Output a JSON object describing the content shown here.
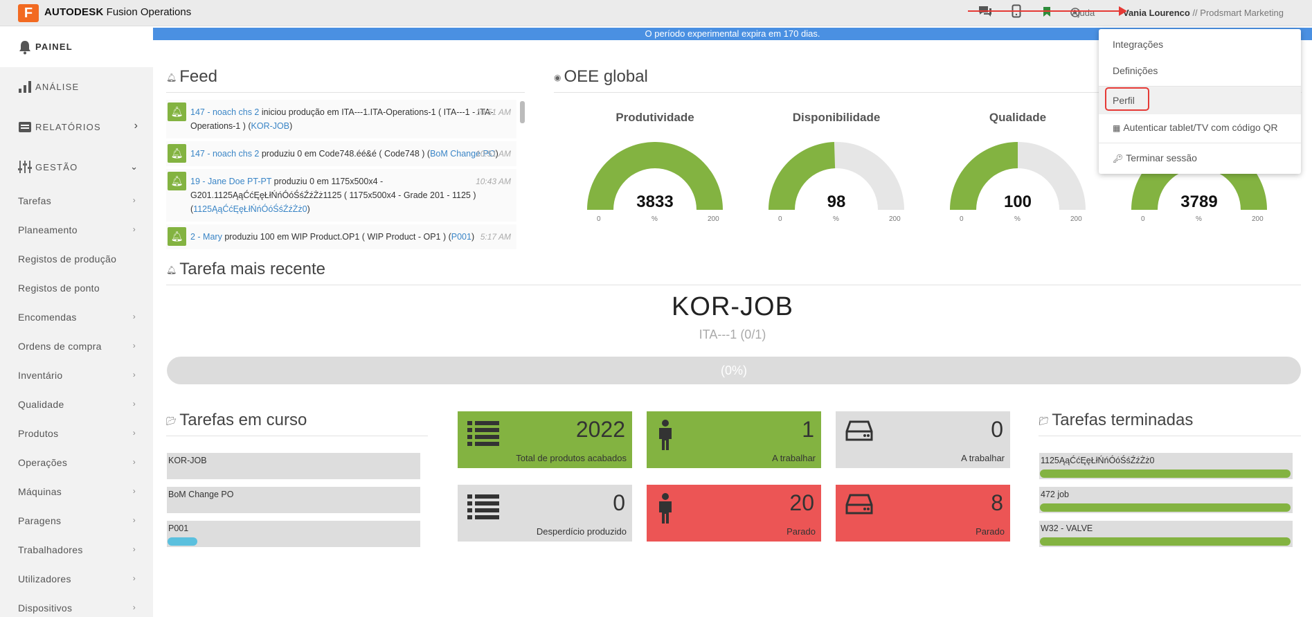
{
  "header": {
    "logo_letter": "F",
    "brand": "AUTODESK",
    "product": "Fusion Operations",
    "help_label": "Ajuda",
    "user_name": "Vania Lourenco",
    "company": "// Prodsmart Marketing",
    "icons": [
      "chat-icon",
      "tablet-icon",
      "bookmark-icon",
      "help-icon"
    ]
  },
  "banner": {
    "text": "O período experimental expira em 170 dias."
  },
  "sidebar": {
    "main": [
      {
        "label": "PAINEL",
        "icon": "bell-icon",
        "active": true
      },
      {
        "label": "ANÁLISE",
        "icon": "bar-chart-icon"
      },
      {
        "label": "RELATÓRIOS",
        "icon": "report-icon"
      },
      {
        "label": "GESTÃO",
        "icon": "management-icon"
      }
    ],
    "sub": [
      "Tarefas",
      "Planeamento",
      "Registos de produção",
      "Registos de ponto",
      "Encomendas",
      "Ordens de compra",
      "Inventário",
      "Qualidade",
      "Produtos",
      "Operações",
      "Máquinas",
      "Paragens",
      "Trabalhadores",
      "Utilizadores",
      "Dispositivos"
    ]
  },
  "feed": {
    "title": "Feed",
    "items": [
      {
        "who": "147 - noach chs 2",
        "text": " iniciou produção em ITA---1.ITA-Operations-1 ( ITA---1 - ITA-Operations-1 ) (",
        "link": "KOR-JOB",
        "tail": ")",
        "time": "10:51 AM"
      },
      {
        "who": "147 - noach chs 2",
        "text": " produziu 0 em Code748.éé&é ( Code748 ) (",
        "link": "BoM Change PO",
        "tail": ")",
        "time": "10:51 AM"
      },
      {
        "who": "19 - Jane Doe PT-PT",
        "text": " produziu 0 em 1175x500x4 - G201.1125ĄąĆćĘęŁłŃńÓóŚśŹźŻż1125 ( 1175x500x4 - Grade 201 - 1125 ) (",
        "link": "1125ĄąĆćĘęŁłŃńÓóŚśŹźŻż0",
        "tail": ")",
        "time": "10:43 AM"
      },
      {
        "who": "2 - Mary",
        "text": " produziu 100 em WIP Product.OP1 ( WIP Product - OP1 ) (",
        "link": "P001",
        "tail": ")",
        "time": "5:17 AM"
      }
    ]
  },
  "oee": {
    "title": "OEE global",
    "gauges": [
      {
        "label": "Produtividade",
        "value": "3833",
        "fraction": 1.0,
        "unit": "%",
        "min": "0",
        "max": "200"
      },
      {
        "label": "Disponibilidade",
        "value": "98",
        "fraction": 0.49,
        "unit": "%",
        "min": "0",
        "max": "200"
      },
      {
        "label": "Qualidade",
        "value": "100",
        "fraction": 0.5,
        "unit": "%",
        "min": "0",
        "max": "200"
      },
      {
        "label": "",
        "value": "3789",
        "fraction": 1.0,
        "unit": "%",
        "min": "0",
        "max": "200"
      }
    ]
  },
  "recent_task": {
    "title": "Tarefa mais recente",
    "name": "KOR-JOB",
    "sub": "ITA---1 (0/1)",
    "progress_text": "(0%)"
  },
  "in_progress": {
    "title": "Tarefas em curso",
    "items": [
      {
        "name": "KOR-JOB",
        "progress": 0
      },
      {
        "name": "BoM Change PO",
        "progress": 0
      },
      {
        "name": "P001",
        "progress": 0.12
      }
    ]
  },
  "tiles": [
    {
      "value": "2022",
      "label": "Total de produtos acabados",
      "color": "#83b341",
      "icon": "list-icon"
    },
    {
      "value": "1",
      "label": "A trabalhar",
      "color": "#83b341",
      "icon": "worker-icon"
    },
    {
      "value": "0",
      "label": "A trabalhar",
      "color": "#dddddd",
      "icon": "machine-icon"
    },
    {
      "value": "0",
      "label": "Desperdício produzido",
      "color": "#dddddd",
      "icon": "list-icon"
    },
    {
      "value": "20",
      "label": "Parado",
      "color": "#ec5555",
      "icon": "worker-icon"
    },
    {
      "value": "8",
      "label": "Parado",
      "color": "#ec5555",
      "icon": "machine-icon"
    }
  ],
  "finished": {
    "title": "Tarefas terminadas",
    "items": [
      {
        "name": "1125ĄąĆćĘęŁłŃńÓóŚśŹźŻż0",
        "progress": 1
      },
      {
        "name": "472 job",
        "progress": 1
      },
      {
        "name": "W32 - VALVE",
        "progress": 1
      }
    ]
  },
  "dropdown": {
    "items": [
      {
        "label": "Integrações",
        "icon": ""
      },
      {
        "label": "Definições",
        "icon": ""
      },
      {
        "label": "Perfil",
        "icon": "",
        "highlighted": true
      },
      {
        "label": "Autenticar tablet/TV com código QR",
        "icon": "qr-icon"
      },
      {
        "label": "Terminar sessão",
        "icon": "key-icon"
      }
    ]
  },
  "colors": {
    "accent_green": "#83b341",
    "danger_red": "#ec5555",
    "banner_blue": "#4a90e2",
    "link_blue": "#3a85c6"
  }
}
